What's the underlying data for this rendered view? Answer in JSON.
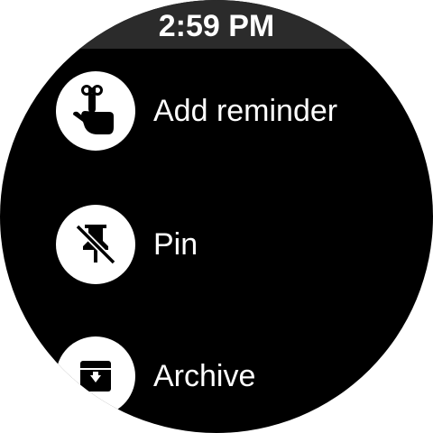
{
  "status_bar": {
    "time": "2:59 PM"
  },
  "menu": {
    "items": [
      {
        "label": "Add reminder",
        "icon": "reminder-finger-icon"
      },
      {
        "label": "Pin",
        "icon": "unpin-icon"
      },
      {
        "label": "Archive",
        "icon": "archive-icon"
      }
    ]
  },
  "colors": {
    "background": "#000000",
    "status_bar": "#2b2b2b",
    "text": "#ffffff",
    "icon_circle": "#ffffff"
  }
}
